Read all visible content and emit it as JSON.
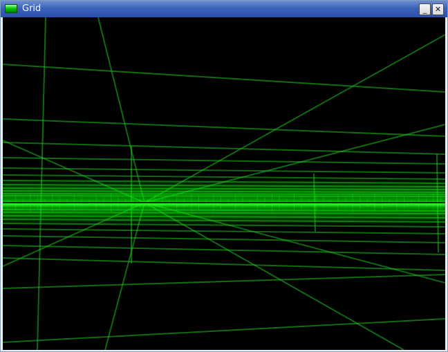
{
  "window": {
    "title": "Grid",
    "app_icon": "green-bar-icon",
    "minimize_icon": "minimize-icon",
    "close_icon": "close-icon",
    "minimize_glyph": "_",
    "close_glyph": "✕"
  },
  "scene": {
    "background_color": "#000000",
    "grid_color": "#1fbf1f",
    "horizon_glow_color": "#00ff00",
    "description_icon": "3d-perspective-grid"
  }
}
